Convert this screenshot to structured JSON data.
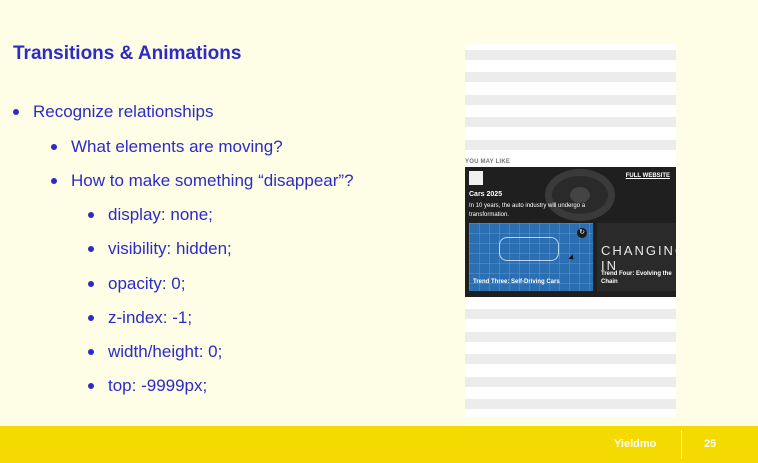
{
  "slide": {
    "title": "Transitions & Animations",
    "bullets": [
      {
        "level": 1,
        "text": "Recognize relationships"
      },
      {
        "level": 2,
        "text": "What elements are moving?"
      },
      {
        "level": 2,
        "text": "How to make something “disappear”?"
      },
      {
        "level": 3,
        "text": "display: none;"
      },
      {
        "level": 3,
        "text": "visibility: hidden;"
      },
      {
        "level": 3,
        "text": "opacity: 0;"
      },
      {
        "level": 3,
        "text": "z-index: -1;"
      },
      {
        "level": 3,
        "text": "width/height: 0;"
      },
      {
        "level": 3,
        "text": "top: -9999px;"
      }
    ]
  },
  "mockup": {
    "section_label": "YOU MAY LIKE",
    "ad": {
      "full_website": "FULL WEBSITE",
      "title": "Cars 2025",
      "description": "In 10 years, the auto industry will undergo a transformation.",
      "card_a_caption": "Trend Three: Self-Driving Cars",
      "card_b_big": "CHANGING IN",
      "card_b_caption": "Trend Four: Evolving the Chain"
    }
  },
  "footer": {
    "brand": "Yieldmo",
    "page_number": "25"
  },
  "colors": {
    "background": "#fefde6",
    "text_accent": "#2c2cc4",
    "footer": "#f5da00"
  }
}
